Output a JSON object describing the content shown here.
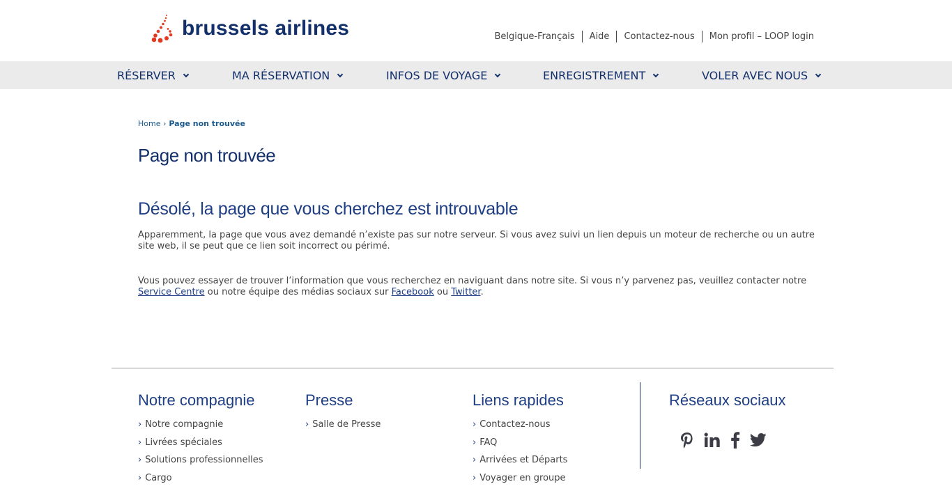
{
  "header": {
    "logo": "brussels airlines",
    "links": [
      "Belgique-Français",
      "Aide",
      "Contactez-nous",
      "Mon profil – LOOP login"
    ]
  },
  "nav": [
    "RÉSERVER",
    "MA RÉSERVATION",
    "INFOS DE VOYAGE",
    "ENREGISTREMENT",
    "VOLER AVEC NOUS"
  ],
  "breadcrumb": {
    "home": "Home",
    "current": "Page non trouvée"
  },
  "main": {
    "title": "Page non trouvée",
    "subtitle": "Désolé, la page que vous cherchez est introuvable",
    "p1": "Apparemment, la page que vous avez demandé n’existe pas sur notre serveur. Si vous avez suivi un lien depuis un moteur de recherche ou un autre site web, il se peut que ce lien soit incorrect ou périmé.",
    "p2a": "Vous pouvez essayer de trouver l’information que vous recherchez en naviguant dans notre site. Si vous n’y parvenez pas, veuillez contacter notre ",
    "service": "Service Centre",
    "p2b": " ou notre équipe des médias sociaux sur ",
    "facebook": "Facebook",
    "p2c": " ou ",
    "twitter": "Twitter",
    "p2d": "."
  },
  "footer": {
    "cols": [
      {
        "title": "Notre compagnie",
        "items": [
          "Notre compagnie",
          "Livrées spéciales",
          "Solutions professionnelles",
          "Cargo"
        ]
      },
      {
        "title": "Presse",
        "items": [
          "Salle de Presse"
        ]
      },
      {
        "title": "Liens rapides",
        "items": [
          "Contactez-nous",
          "FAQ",
          "Arrivées et Départs",
          "Voyager en groupe"
        ]
      }
    ],
    "social_title": "Réseaux sociaux",
    "social_icons": [
      "pinterest-icon",
      "linkedin-icon",
      "facebook-icon",
      "twitter-icon"
    ]
  },
  "colors": {
    "brand": "#14306b",
    "logo_red": "#e2391f",
    "nav_bg": "#ebebeb"
  }
}
